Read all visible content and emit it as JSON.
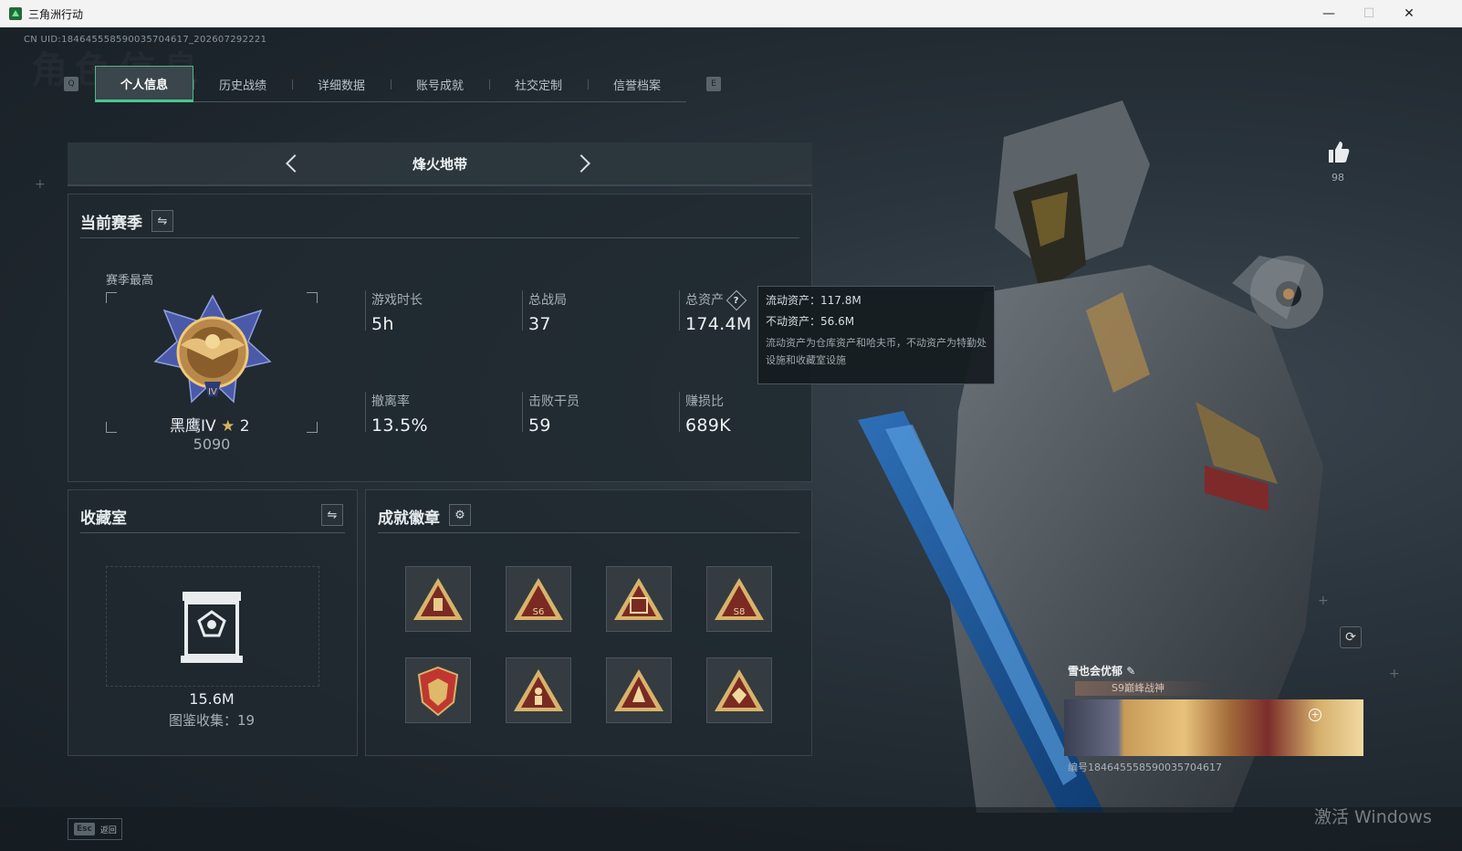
{
  "window": {
    "title": "三角洲行动",
    "min": "—",
    "max": "☐",
    "close": "✕"
  },
  "uid": "CN UID:18464555859003570​4617_202607292221",
  "watermark": "角色信息",
  "tabs": {
    "prev_key": "Q",
    "next_key": "E",
    "items": [
      "个人信息",
      "历史战绩",
      "详细数据",
      "账号成就",
      "社交定制",
      "信誉档案"
    ]
  },
  "mode": {
    "title": "烽火地带"
  },
  "season": {
    "title": "当前赛季",
    "best_label": "赛季最高",
    "rank_name": "黑鹰IV",
    "rank_star": "★",
    "rank_stars": "2",
    "rank_score": "5090",
    "stats": [
      {
        "label": "游戏时长",
        "value": "5h"
      },
      {
        "label": "总战局",
        "value": "37"
      },
      {
        "label": "总资产",
        "value": "174.4M"
      },
      {
        "label": "撤离率",
        "value": "13.5%"
      },
      {
        "label": "击败干员",
        "value": "59"
      },
      {
        "label": "赚损比",
        "value": "689K"
      }
    ],
    "help_icon": "?"
  },
  "tooltip": {
    "liquid": "流动资产：117.8M",
    "fixed": "不动资产：56.6M",
    "desc": "流动资产为仓库资产和哈夫币，不动资产为特勤处设施和收藏室设施"
  },
  "vault": {
    "title": "收藏室",
    "value": "15.6M",
    "collection": "图鉴收集：19"
  },
  "badges": {
    "title": "成就徽章",
    "count": 8
  },
  "profile": {
    "likes": "98",
    "name": "雪也会优郁",
    "title": "S9巅峰战神",
    "id": "编号18464555859003570​4617"
  },
  "footer": {
    "esc": "Esc",
    "back": "返回"
  },
  "activate": "激活 Windows",
  "colors": {
    "accent": "#46c98d",
    "gold": "#d9b45c"
  }
}
